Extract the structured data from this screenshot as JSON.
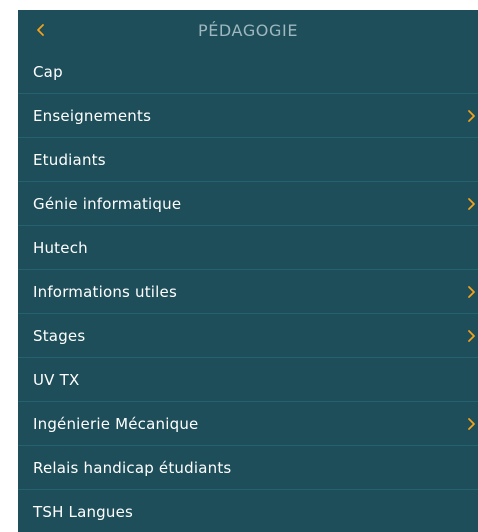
{
  "header": {
    "title": "PÉDAGOGIE",
    "back_icon": "chevron-left-icon"
  },
  "colors": {
    "panel_bg": "#1d4e5a",
    "divider": "#246270",
    "accent": "#f2a21b",
    "title_text": "#9fb7be",
    "item_text": "#ffffff"
  },
  "menu": {
    "items": [
      {
        "label": "Cap",
        "has_submenu": false
      },
      {
        "label": "Enseignements",
        "has_submenu": true
      },
      {
        "label": "Etudiants",
        "has_submenu": false
      },
      {
        "label": "Génie informatique",
        "has_submenu": true
      },
      {
        "label": "Hutech",
        "has_submenu": false
      },
      {
        "label": "Informations utiles",
        "has_submenu": true
      },
      {
        "label": "Stages",
        "has_submenu": true
      },
      {
        "label": "UV TX",
        "has_submenu": false
      },
      {
        "label": "Ingénierie Mécanique",
        "has_submenu": true
      },
      {
        "label": "Relais handicap étudiants",
        "has_submenu": false
      },
      {
        "label": "TSH Langues",
        "has_submenu": false
      }
    ]
  }
}
